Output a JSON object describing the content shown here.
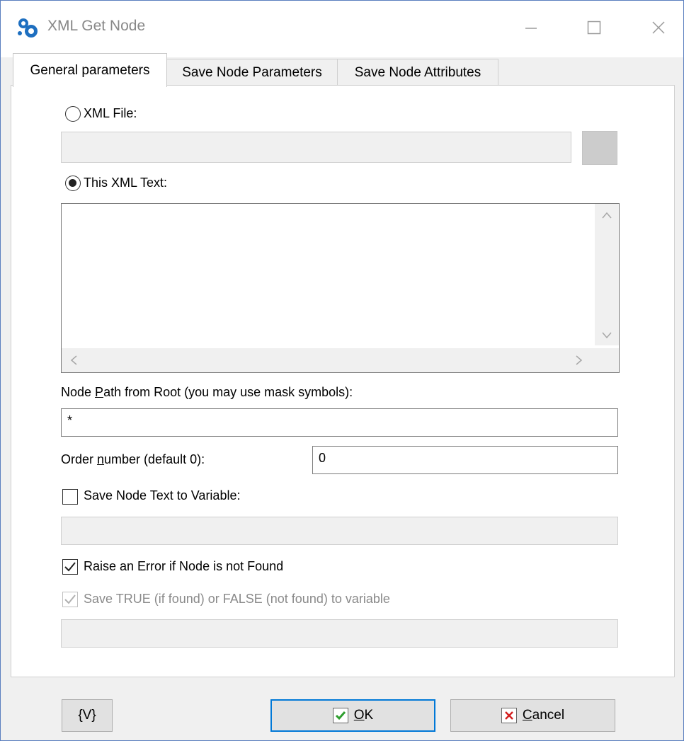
{
  "window": {
    "title": "XML Get Node",
    "icon": "gears-icon"
  },
  "tabs": [
    {
      "label": "General parameters",
      "active": true
    },
    {
      "label": "Save Node Parameters",
      "active": false
    },
    {
      "label": "Save Node Attributes",
      "active": false
    }
  ],
  "source": {
    "xml_file_label": "XML File:",
    "xml_file_selected": false,
    "xml_file_value": "",
    "xml_text_label": "This XML Text:",
    "xml_text_selected": true,
    "xml_text_value": ""
  },
  "node_path": {
    "label_pre": "Node ",
    "label_mnemonic": "P",
    "label_post": "ath from Root (you may use mask symbols):",
    "value": "*"
  },
  "order_number": {
    "label_pre": "Order ",
    "label_mnemonic": "n",
    "label_post": "umber (default 0):",
    "value": "0"
  },
  "save_text": {
    "label": "Save Node Text to Variable:",
    "checked": false,
    "value": ""
  },
  "raise_error": {
    "label": "Raise an Error if Node is not Found",
    "checked": true
  },
  "save_bool": {
    "label": "Save TRUE (if found) or FALSE (not found) to variable",
    "checked": true,
    "enabled": false,
    "value": ""
  },
  "footer": {
    "variables_button": "{V}",
    "ok_mnemonic": "O",
    "ok_rest": "K",
    "cancel_mnemonic": "C",
    "cancel_rest": "ancel"
  },
  "colors": {
    "default_button_border": "#0078d7",
    "ok_check": "#2e9e2e",
    "cancel_x": "#d42020"
  }
}
